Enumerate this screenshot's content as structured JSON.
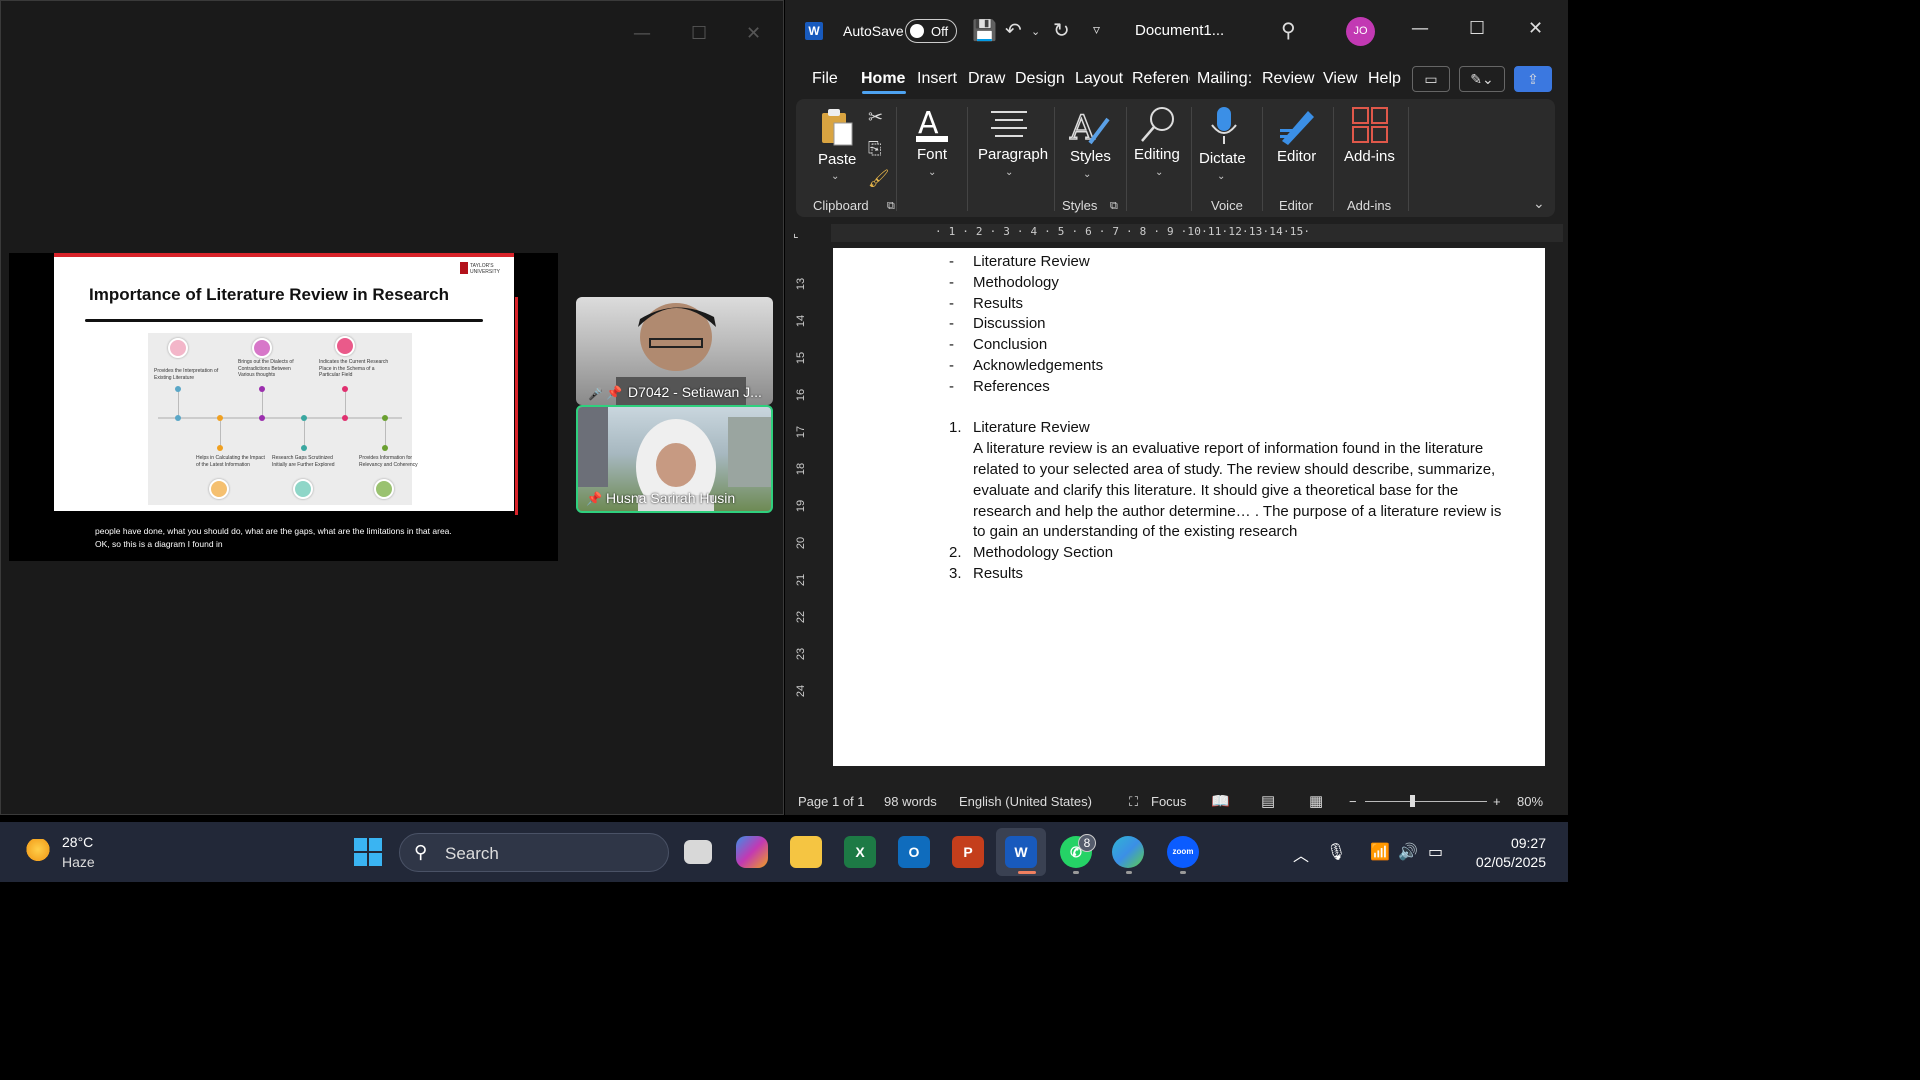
{
  "zoom_window": {
    "slide": {
      "title": "Importance of Literature Review in Research",
      "logo_text": [
        "TAYLOR'S",
        "UNIVERSITY"
      ],
      "diagram_labels_top": [
        "Provides the Interpretation of Existing Literature",
        "Brings out the Dialects of Contradictions Between Various thoughts",
        "Indicates the Current Research Place in the Schema of a Particular Field"
      ],
      "diagram_labels_bottom": [
        "Helps in Calculating the Impact of the Latest Information",
        "Research Gaps Scrutinized Initially are Further Explored",
        "Provides Information for Relevancy and Coherency"
      ],
      "colors": [
        "#5aa7c7",
        "#f0a020",
        "#9b2fae",
        "#3aa7a0",
        "#e0306f",
        "#6aa030"
      ]
    },
    "caption_lines": [
      "people have done, what you should do, what are the gaps, what are the limitations in that area.",
      "OK, so this is a diagram I found in"
    ],
    "participants": [
      {
        "name": "D7042 - Setiawan J...",
        "muted": true
      },
      {
        "name": "Husna Sarirah Husin",
        "muted": false
      }
    ]
  },
  "word": {
    "autosave_label": "AutoSave",
    "autosave_state": "Off",
    "doc_title": "Document1...",
    "avatar_initials": "JO",
    "tabs": [
      "File",
      "Home",
      "Insert",
      "Draw",
      "Design",
      "Layout",
      "Referenc",
      "Mailing:",
      "Review",
      "View",
      "Help"
    ],
    "active_tab": "Home",
    "ribbon": {
      "paste": "Paste",
      "clipboard": "Clipboard",
      "font": "Font",
      "paragraph": "Paragraph",
      "styles_btn": "Styles",
      "styles_grp": "Styles",
      "editing": "Editing",
      "dictate": "Dictate",
      "voice": "Voice",
      "editor_btn": "Editor",
      "editor_grp": "Editor",
      "addins_btn": "Add-ins",
      "addins_grp": "Add-ins"
    },
    "ruler_numbers": "· 1 · 2 · 3 · 4 · 5 · 6 · 7 · 8 · 9 ·10·11·12·13·14·15·",
    "vruler_numbers": [
      "13",
      "14",
      "15",
      "16",
      "17",
      "18",
      "19",
      "20",
      "21",
      "22",
      "23",
      "24"
    ],
    "document": {
      "bullets": [
        "Literature Review",
        "Methodology",
        "Results",
        "Discussion",
        "Conclusion",
        "Acknowledgements",
        "References"
      ],
      "dash": "-",
      "numbered": [
        {
          "n": "1.",
          "title": "Literature Review",
          "para": "A literature review is an evaluative report of information found in the literature related to your selected area of study. The review should describe, summarize, evaluate and clarify this literature. It should give a theoretical base for the research and help the author determine… . The purpose of a literature review is to gain an understanding of the existing research"
        },
        {
          "n": "2.",
          "title": "Methodology Section"
        },
        {
          "n": "3.",
          "title": "Results"
        }
      ]
    },
    "status": {
      "page": "Page 1 of 1",
      "words": "98 words",
      "language": "English (United States)",
      "focus": "Focus",
      "zoom": "80%"
    }
  },
  "taskbar": {
    "temp": "28°C",
    "weather": "Haze",
    "search_placeholder": "Search",
    "whatsapp_badge": "8",
    "time": "09:27",
    "date": "02/05/2025"
  }
}
